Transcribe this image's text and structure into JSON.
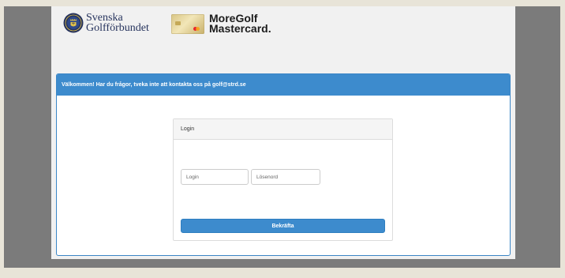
{
  "header": {
    "sgf_logo": {
      "line1": "Svenska",
      "line2": "Golfförbundet"
    },
    "moregolf_logo": {
      "line1": "MoreGolf",
      "line2": "Mastercard."
    }
  },
  "welcome_message": "Välkommen! Har du frågor, tveka inte att kontakta oss på golf@strd.se",
  "login": {
    "title": "Login",
    "username_placeholder": "Login",
    "password_placeholder": "Lösenord",
    "submit_label": "Bekräfta"
  },
  "colors": {
    "primary": "#3d8bcd",
    "sgf_navy": "#26335d",
    "card_gold": "#d8c585"
  }
}
